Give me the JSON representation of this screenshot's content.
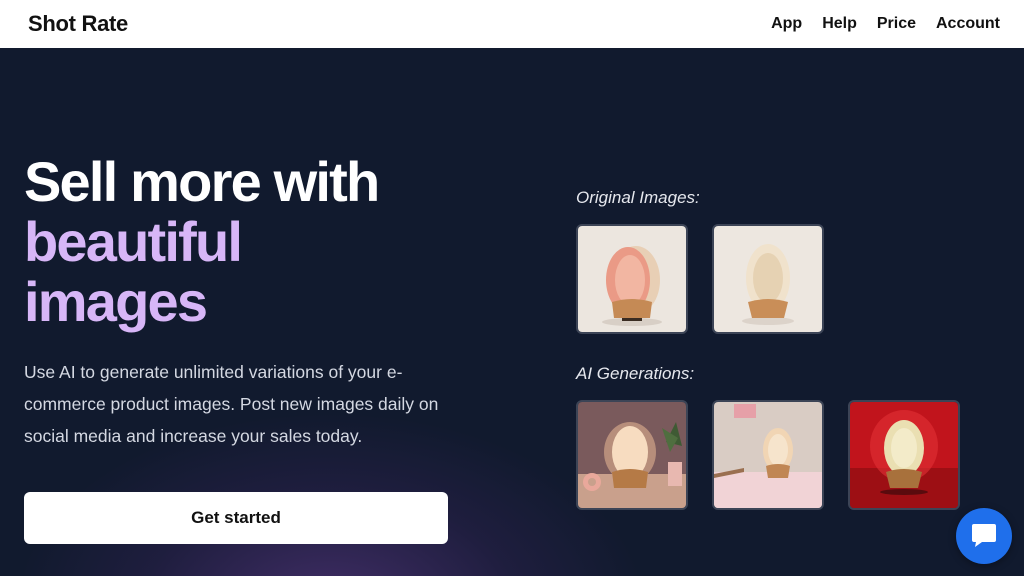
{
  "nav": {
    "brand": "Shot Rate",
    "links": [
      "App",
      "Help",
      "Price",
      "Account"
    ]
  },
  "hero": {
    "headline_line1": "Sell more with",
    "headline_line2": "beautiful",
    "headline_line3": "images",
    "subtitle": "Use AI to generate unlimited variations of your e-commerce product images. Post new images daily on social media and increase your sales today.",
    "cta_label": "Get started"
  },
  "gallery": {
    "original_label": "Original Images:",
    "ai_label": "AI Generations:"
  },
  "icons": {
    "chat": "chat-bubble-icon"
  },
  "colors": {
    "background": "#111a2e",
    "accent_purple": "#d7b6f7",
    "chat_blue": "#1f6feb"
  }
}
